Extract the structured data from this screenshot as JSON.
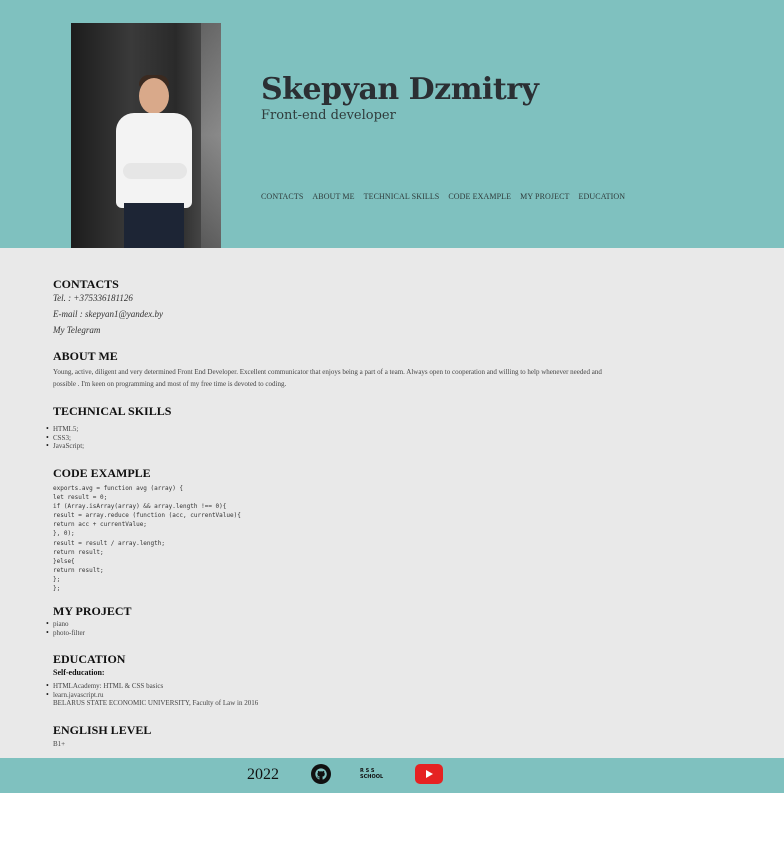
{
  "header": {
    "name": "Skepyan Dzmitry",
    "role": "Front-end developer",
    "nav": [
      "CONTACTS",
      "ABOUT ME",
      "TECHNICAL SKILLS",
      "CODE EXAMPLE",
      "MY PROJECT",
      "EDUCATION"
    ]
  },
  "contacts": {
    "title": "CONTACTS",
    "tel": "Tel. : +375336181126",
    "email": "E-mail : skepyan1@yandex.by",
    "telegram": "My Telegram"
  },
  "about": {
    "title": "ABOUT ME",
    "text": "Young, active, diligent and very determined Front End Developer. Excellent communicator that enjoys being a part of a team. Always open to cooperation and willing to help whenever needed and possible . I'm keen on programming and most of my free time is devoted to coding."
  },
  "skills": {
    "title": "TECHNICAL SKILLS",
    "items": [
      "HTML5;",
      "CSS3;",
      "JavaScript;"
    ]
  },
  "code": {
    "title": "CODE EXAMPLE",
    "lines": [
      "exports.avg = function avg (array) {",
      "let result = 0;",
      "if (Array.isArray(array) && array.length !== 0){",
      "result = array.reduce (function (acc, currentValue){",
      "return acc + currentValue;",
      "}, 0);",
      "result = result / array.length;",
      "return result;",
      "}else{",
      "return result;",
      "};",
      "};"
    ]
  },
  "projects": {
    "title": "MY PROJECT",
    "items": [
      "piano",
      "photo-filter"
    ]
  },
  "education": {
    "title": "EDUCATION",
    "self_title": "Self-education:",
    "items": [
      "HTMLAcademy: HTML & CSS basics",
      "learn.javascript.ru"
    ],
    "university": "BELARUS STATE ECONOMIC UNIVERSITY, Faculty of Law in 2016"
  },
  "english": {
    "title": "ENGLISH LEVEL",
    "value": "B1+"
  },
  "footer": {
    "year": "2022",
    "rss_label_top": "R S S",
    "rss_label_bottom": "SCHOOL",
    "icons": [
      "github-icon",
      "rss-school-icon",
      "youtube-icon"
    ]
  },
  "colors": {
    "teal": "#7fc1bf",
    "content_bg": "#e9e9e9",
    "youtube_red": "#e52222"
  }
}
